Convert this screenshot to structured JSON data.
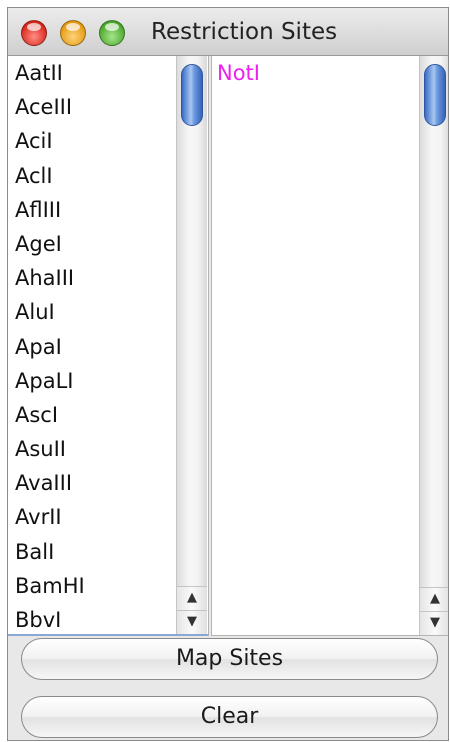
{
  "window": {
    "title": "Restriction Sites"
  },
  "enzyme_list": {
    "items": [
      "AatII",
      "AceIII",
      "AciI",
      "AclI",
      "AflIII",
      "AgeI",
      "AhaIII",
      "AluI",
      "ApaI",
      "ApaLI",
      "AscI",
      "AsuII",
      "AvaIII",
      "AvrII",
      "BalI",
      "BamHI",
      "BbvI"
    ]
  },
  "selected_list": {
    "items": [
      "NotI"
    ],
    "text_color": "#ee22ee"
  },
  "buttons": {
    "map_sites": "Map Sites",
    "clear": "Clear"
  },
  "icons": {
    "scroll_up": "up-arrow-icon",
    "scroll_down": "down-arrow-icon"
  }
}
